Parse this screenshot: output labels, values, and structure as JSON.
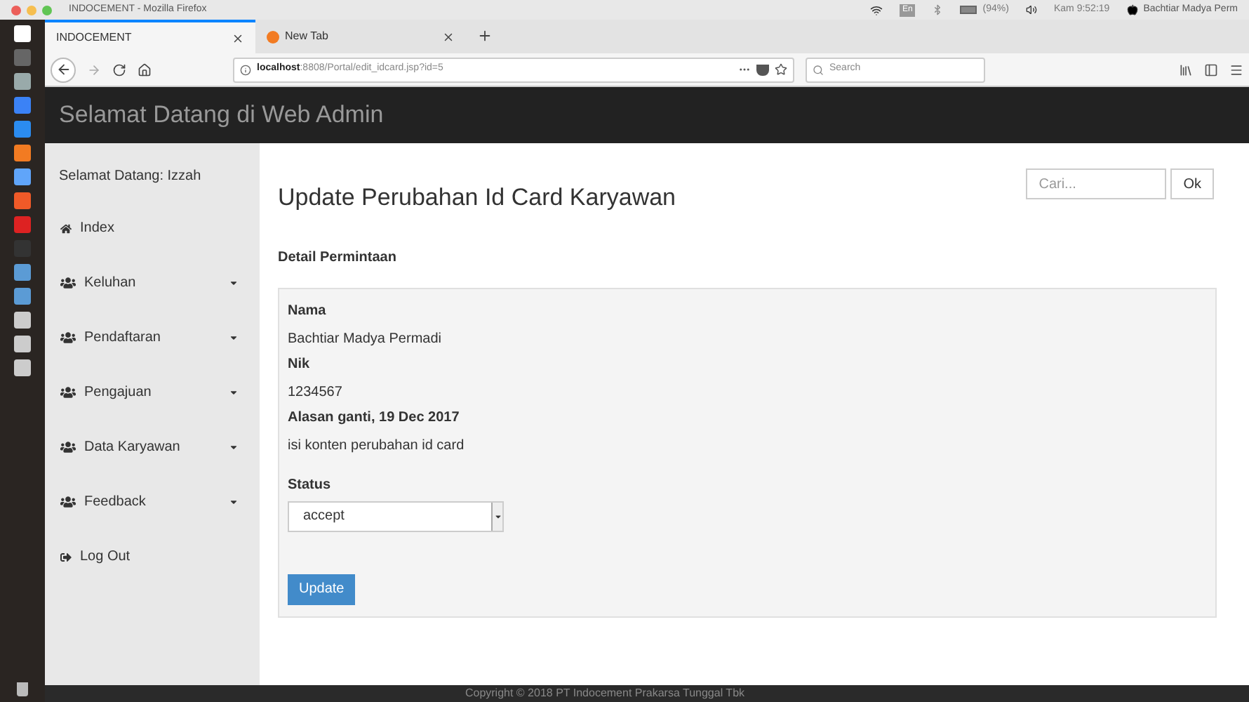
{
  "menubar": {
    "window_title": "INDOCEMENT - Mozilla Firefox",
    "keyboard": "En",
    "battery": "(94%)",
    "clock": "Kam 9:52:19",
    "user": "Bachtiar Madya Perm"
  },
  "browser": {
    "tabs": [
      {
        "label": "INDOCEMENT",
        "selected": true
      },
      {
        "label": "New Tab",
        "selected": false
      }
    ],
    "url_host": "localhost",
    "url_rest": ":8808/Portal/edit_idcard.jsp?id=5",
    "search_placeholder": "Search"
  },
  "header": {
    "title": "Selamat Datang di Web Admin"
  },
  "sidebar": {
    "greeting": "Selamat Datang: Izzah",
    "items": [
      {
        "label": "Index",
        "kind": "home"
      },
      {
        "label": "Keluhan",
        "kind": "dropdown"
      },
      {
        "label": "Pendaftaran",
        "kind": "dropdown"
      },
      {
        "label": "Pengajuan",
        "kind": "dropdown"
      },
      {
        "label": "Data Karyawan",
        "kind": "dropdown"
      },
      {
        "label": "Feedback",
        "kind": "dropdown"
      },
      {
        "label": "Log Out",
        "kind": "logout"
      }
    ]
  },
  "main": {
    "title": "Update Perubahan Id Card Karyawan",
    "search_placeholder": "Cari...",
    "search_button": "Ok",
    "section": "Detail Permintaan",
    "fields": [
      {
        "kind": "label",
        "text": "Nama"
      },
      {
        "kind": "value",
        "text": "Bachtiar Madya Permadi"
      },
      {
        "kind": "label",
        "text": "Nik"
      },
      {
        "kind": "value",
        "text": "1234567"
      },
      {
        "kind": "label",
        "text": "Alasan ganti, 19 Dec 2017"
      },
      {
        "kind": "value",
        "text": "isi konten perubahan id card"
      }
    ],
    "status_label": "Status",
    "status_value": "accept",
    "submit": "Update"
  },
  "footer": {
    "text": "Copyright © 2018 PT Indocement Prakarsa Tunggal Tbk"
  }
}
